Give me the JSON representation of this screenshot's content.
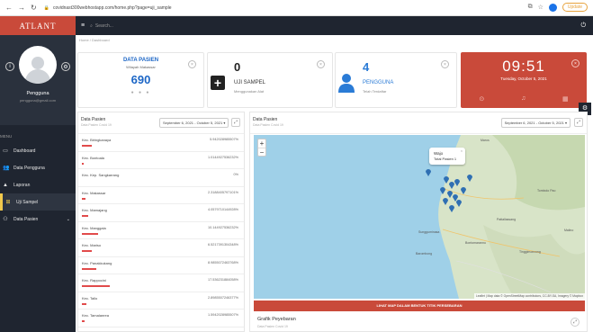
{
  "browser": {
    "url": "covidnast300webhostapp.com/home.php?page=uji_sample",
    "update_label": "Update"
  },
  "brand": "ATLANT",
  "profile": {
    "name": "Pengguna",
    "email": "pengguna@gmail.com"
  },
  "sidebar": {
    "menu_label": "MENU",
    "items": [
      {
        "label": "Dashboard",
        "icon": "desktop-icon"
      },
      {
        "label": "Data Pengguna",
        "icon": "users-icon"
      },
      {
        "label": "Laporan",
        "icon": "warning-icon"
      },
      {
        "label": "Uji Sampel",
        "icon": "plus-square-icon",
        "active": true
      },
      {
        "label": "Data Pasien",
        "icon": "user-plus-icon"
      }
    ]
  },
  "topbar": {
    "search_placeholder": "Search..."
  },
  "breadcrumb": "Home / Dashboard",
  "cards": {
    "pasien": {
      "title": "DATA PASIEN",
      "subtitle": "Wilayah Makassar",
      "value": "690"
    },
    "uji": {
      "value": "0",
      "title": "UJI SAMPEL",
      "subtitle": "Menggunakan Alat"
    },
    "pengguna": {
      "value": "4",
      "title": "PENGGUNA",
      "subtitle": "Telah Terdaftar"
    },
    "clock": {
      "time": "09:51",
      "date": "Tuesday, October 5, 2021"
    }
  },
  "left_panel": {
    "title": "Data Pasien",
    "subtitle": "Data Pasien Covid 19",
    "range": "September 6, 2021 - October 5, 2021 ▾",
    "rows": [
      {
        "name": "Kec. Biringkanaya",
        "pct": "5.942028985507%",
        "frac": 0.06
      },
      {
        "name": "Kec. Bontoala",
        "pct": "1.0144927536232%",
        "frac": 0.01
      },
      {
        "name": "Kec. Kep. Sangkarrang",
        "pct": "0%",
        "frac": 0
      },
      {
        "name": "Kec. Makassar",
        "pct": "2.3188405797101%",
        "frac": 0.023
      },
      {
        "name": "Kec. Mamajang",
        "pct": "4.0579710144928%",
        "frac": 0.041
      },
      {
        "name": "Kec. Manggala",
        "pct": "10.144927536232%",
        "frac": 0.1
      },
      {
        "name": "Kec. Mariso",
        "pct": "6.5217391304348%",
        "frac": 0.065
      },
      {
        "name": "Kec. Panakkukang",
        "pct": "8.9855072463768%",
        "frac": 0.09
      },
      {
        "name": "Kec. Rappocini",
        "pct": "17.536231884058%",
        "frac": 0.175
      },
      {
        "name": "Kec. Tallo",
        "pct": "2.8985507246377%",
        "frac": 0.029
      },
      {
        "name": "Kec. Tamalanrea",
        "pct": "1.5942028985507%",
        "frac": 0.016
      }
    ]
  },
  "right_panel": {
    "title": "Data Pasien",
    "subtitle": "Data Pasien Covid 19",
    "range": "September 6, 2021 - October 5, 2021 ▾",
    "popup": {
      "title": "Wajo",
      "value": "Total Pasien 1"
    },
    "attribution": "Leaflet | Map data © OpenStreetMap contributors, CC-BY-SA, Imagery © Mapbox",
    "labels": [
      "Maros",
      "Sungguminasa",
      "Barombong",
      "Bontomarannu",
      "Pattallassang",
      "Tombolo Pao",
      "Malino",
      "Tinggimoncong"
    ],
    "map_button": "LIHAT MAP DALAM BENTUK TITIK PERSEBARAN",
    "grafik_title": "Grafik Peyebaran",
    "grafik_subtitle": "Data Pasien Covid 19"
  }
}
